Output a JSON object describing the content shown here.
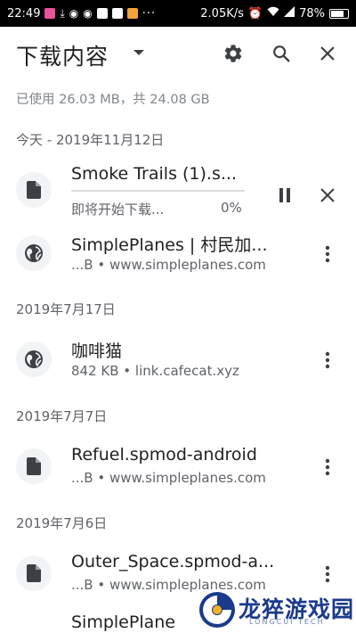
{
  "status_bar": {
    "time": "22:49",
    "net_speed": "2.05K/s",
    "battery": "78%"
  },
  "header": {
    "title": "下载内容",
    "icons": [
      "chevron-down-icon",
      "settings-icon",
      "search-icon",
      "close-icon"
    ]
  },
  "storage_text": "已使用 26.03 MB，共 24.08 GB",
  "groups": [
    {
      "date": "今天 - 2019年11月12日",
      "items": [
        {
          "title": "Smoke Trails (1).s...",
          "status": "即将开始下载...",
          "percent": "0%",
          "progress": 0,
          "icon": "file-icon",
          "in_progress": true
        },
        {
          "title": "SimplePlanes | 村民加...",
          "subtitle": "...B • www.simpleplanes.com",
          "icon": "globe-icon"
        }
      ]
    },
    {
      "date": "2019年7月17日",
      "items": [
        {
          "title": "咖啡猫",
          "subtitle": "842 KB • link.cafecat.xyz",
          "icon": "globe-icon"
        }
      ]
    },
    {
      "date": "2019年7月7日",
      "items": [
        {
          "title": "Refuel.spmod-android",
          "subtitle": "...B • www.simpleplanes.com",
          "icon": "file-icon"
        }
      ]
    },
    {
      "date": "2019年7月6日",
      "items": [
        {
          "title": "Outer_Space.spmod-a...",
          "subtitle": "...B • www.simpleplanes.com",
          "icon": "file-icon"
        },
        {
          "title": "SimplePlane",
          "icon": "file-icon"
        }
      ]
    }
  ],
  "watermark": {
    "name": "龙猝游戏园",
    "sub": "LONGCUI TECH"
  },
  "colors": {
    "accent": "#1a73e8",
    "icon_bg": "#f1f3f4",
    "text_secondary": "#5f6368"
  }
}
